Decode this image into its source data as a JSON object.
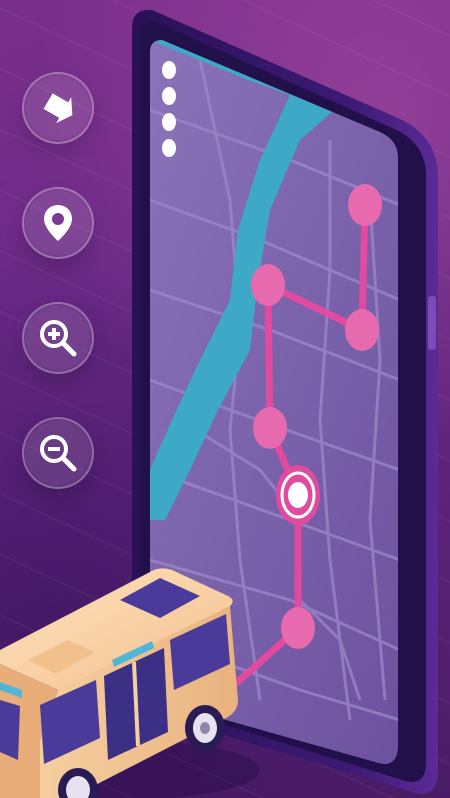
{
  "controls": [
    {
      "name": "navigate",
      "icon": "arrow-icon"
    },
    {
      "name": "location",
      "icon": "map-pin-icon"
    },
    {
      "name": "zoom-in",
      "icon": "zoom-in-icon"
    },
    {
      "name": "zoom-out",
      "icon": "zoom-out-icon"
    }
  ],
  "colors": {
    "background": "#6a2a86",
    "phone_frame": "#3c1a74",
    "screen": "#7a68b0",
    "river": "#3ea9c6",
    "route": "#e04a9f",
    "bus_body": "#f6cf9f",
    "bus_windows": "#4a3a9a"
  },
  "route": {
    "stops": 6
  }
}
